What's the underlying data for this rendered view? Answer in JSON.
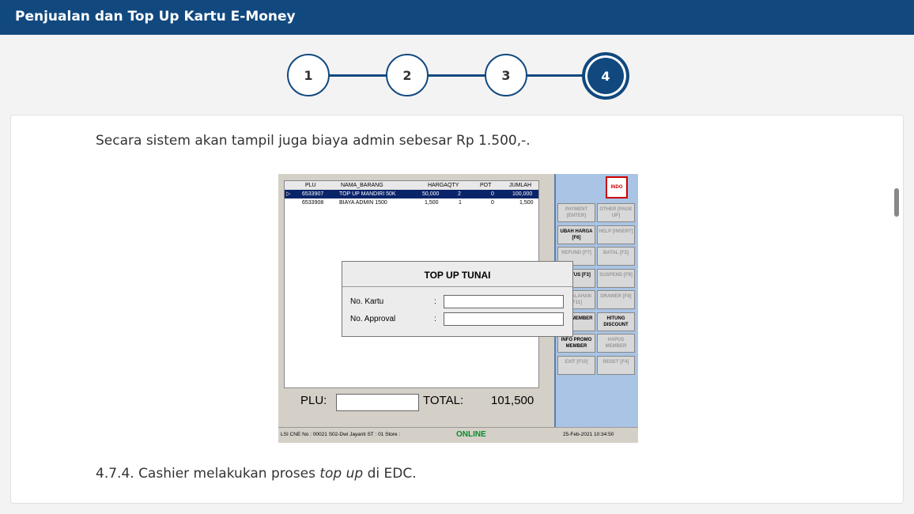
{
  "header": {
    "title": "Penjualan dan Top Up Kartu E-Money"
  },
  "steps": [
    "1",
    "2",
    "3",
    "4"
  ],
  "content": {
    "paragraph1": "Secara sistem akan tampil juga biaya admin sebesar Rp 1.500,-.",
    "paragraph2_prefix": "4.7.4.  Cashier melakukan proses ",
    "paragraph2_italic": "top up",
    "paragraph2_suffix": " di EDC."
  },
  "pos": {
    "columns": [
      "PLU",
      "NAMA_BARANG",
      "HARGA",
      "QTY",
      "POT",
      "JUMLAH"
    ],
    "rows": [
      {
        "marker": "▷",
        "plu": "6533907",
        "nama": "TOP UP MANDIRI 50K",
        "harga": "50,000",
        "qty": "2",
        "pot": "0",
        "jumlah": "100,000"
      },
      {
        "marker": "",
        "plu": "6533908",
        "nama": "BIAYA ADMIN 1500",
        "harga": "1,500",
        "qty": "1",
        "pot": "0",
        "jumlah": "1,500"
      }
    ],
    "dialog": {
      "title": "TOP UP TUNAI",
      "label_kartu": "No. Kartu",
      "label_approval": "No. Approval",
      "colon": ":"
    },
    "logo_text": "INDO",
    "buttons": [
      {
        "label": "PAYMENT [ENTER]",
        "enabled": false
      },
      {
        "label": "OTHER [PAGE UP]",
        "enabled": false
      },
      {
        "label": "UBAH HARGA [F6]",
        "enabled": true
      },
      {
        "label": "HELP [INSERT]",
        "enabled": false
      },
      {
        "label": "REFUND [F7]",
        "enabled": false
      },
      {
        "label": "BATAL [F2]",
        "enabled": false
      },
      {
        "label": "STATUS [F3]",
        "enabled": true
      },
      {
        "label": "SUSPEND [F9]",
        "enabled": false
      },
      {
        "label": "KESALAHAN [F11]",
        "enabled": false
      },
      {
        "label": "DRAWER [F8]",
        "enabled": false
      },
      {
        "label": "CEK MEMBER",
        "enabled": true
      },
      {
        "label": "HITUNG DISCOUNT",
        "enabled": true
      },
      {
        "label": "INFO PROMO MEMBER",
        "enabled": true
      },
      {
        "label": "HAPUS MEMBER",
        "enabled": false
      },
      {
        "label": "EXIT [F10]",
        "enabled": false
      },
      {
        "label": "RESET [F4]",
        "enabled": false
      }
    ],
    "plu_label": "PLU:",
    "total_label": "TOTAL:",
    "total_value": "101,500",
    "status": {
      "left": "LSI CNE  No : 00021  S02-Dwi Jayanti  ST : 01  Store :",
      "online": "ONLINE",
      "datetime": "25-Feb-2021 10:34:50"
    }
  }
}
